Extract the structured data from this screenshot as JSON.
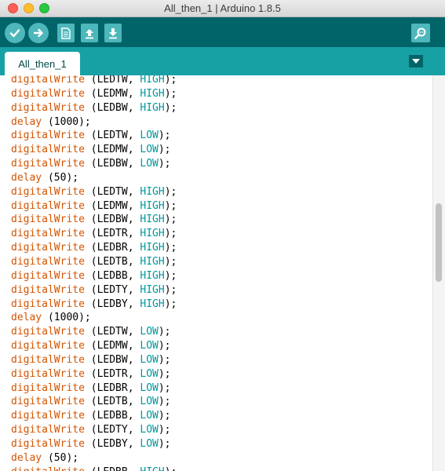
{
  "window": {
    "title": "All_then_1 | Arduino 1.8.5"
  },
  "toolbar": {
    "buttons": [
      {
        "name": "verify",
        "icon": "check-icon"
      },
      {
        "name": "upload",
        "icon": "arrow-right-icon"
      },
      {
        "name": "new",
        "icon": "document-icon"
      },
      {
        "name": "open",
        "icon": "arrow-up-icon"
      },
      {
        "name": "save",
        "icon": "arrow-down-icon"
      },
      {
        "name": "serial-monitor",
        "icon": "magnifier-icon"
      }
    ]
  },
  "tabs": [
    {
      "label": "All_then_1",
      "active": true
    }
  ],
  "editor": {
    "lines": [
      {
        "fn": "digitalWrite",
        "args": " (LEDTW, ",
        "const": "HIGH",
        "end": ");"
      },
      {
        "fn": "digitalWrite",
        "args": " (LEDMW, ",
        "const": "HIGH",
        "end": ");"
      },
      {
        "fn": "digitalWrite",
        "args": " (LEDBW, ",
        "const": "HIGH",
        "end": ");"
      },
      {
        "fn": "delay",
        "args": " (1000);",
        "const": "",
        "end": ""
      },
      {
        "fn": "digitalWrite",
        "args": " (LEDTW, ",
        "const": "LOW",
        "end": ");"
      },
      {
        "fn": "digitalWrite",
        "args": " (LEDMW, ",
        "const": "LOW",
        "end": ");"
      },
      {
        "fn": "digitalWrite",
        "args": " (LEDBW, ",
        "const": "LOW",
        "end": ");"
      },
      {
        "fn": "delay",
        "args": " (50);",
        "const": "",
        "end": ""
      },
      {
        "fn": "digitalWrite",
        "args": " (LEDTW, ",
        "const": "HIGH",
        "end": ");"
      },
      {
        "fn": "digitalWrite",
        "args": " (LEDMW, ",
        "const": "HIGH",
        "end": ");"
      },
      {
        "fn": "digitalWrite",
        "args": " (LEDBW, ",
        "const": "HIGH",
        "end": ");"
      },
      {
        "fn": "digitalWrite",
        "args": " (LEDTR, ",
        "const": "HIGH",
        "end": ");"
      },
      {
        "fn": "digitalWrite",
        "args": " (LEDBR, ",
        "const": "HIGH",
        "end": ");"
      },
      {
        "fn": "digitalWrite",
        "args": " (LEDTB, ",
        "const": "HIGH",
        "end": ");"
      },
      {
        "fn": "digitalWrite",
        "args": " (LEDBB, ",
        "const": "HIGH",
        "end": ");"
      },
      {
        "fn": "digitalWrite",
        "args": " (LEDTY, ",
        "const": "HIGH",
        "end": ");"
      },
      {
        "fn": "digitalWrite",
        "args": " (LEDBY, ",
        "const": "HIGH",
        "end": ");"
      },
      {
        "fn": "delay",
        "args": " (1000);",
        "const": "",
        "end": ""
      },
      {
        "fn": "digitalWrite",
        "args": " (LEDTW, ",
        "const": "LOW",
        "end": ");"
      },
      {
        "fn": "digitalWrite",
        "args": " (LEDMW, ",
        "const": "LOW",
        "end": ");"
      },
      {
        "fn": "digitalWrite",
        "args": " (LEDBW, ",
        "const": "LOW",
        "end": ");"
      },
      {
        "fn": "digitalWrite",
        "args": " (LEDTR, ",
        "const": "LOW",
        "end": ");"
      },
      {
        "fn": "digitalWrite",
        "args": " (LEDBR, ",
        "const": "LOW",
        "end": ");"
      },
      {
        "fn": "digitalWrite",
        "args": " (LEDTB, ",
        "const": "LOW",
        "end": ");"
      },
      {
        "fn": "digitalWrite",
        "args": " (LEDBB, ",
        "const": "LOW",
        "end": ");"
      },
      {
        "fn": "digitalWrite",
        "args": " (LEDTY, ",
        "const": "LOW",
        "end": ");"
      },
      {
        "fn": "digitalWrite",
        "args": " (LEDBY, ",
        "const": "LOW",
        "end": ");"
      },
      {
        "fn": "delay",
        "args": " (50);",
        "const": "",
        "end": ""
      },
      {
        "fn": "digitalWrite",
        "args": " (LEDBB, ",
        "const": "HIGH",
        "end": ");"
      }
    ]
  },
  "colors": {
    "toolbar_bg": "#006468",
    "tabbar_bg": "#17a1a5",
    "button_bg": "#4db7bb",
    "function_keyword": "#d35400",
    "constant_keyword": "#00979c"
  }
}
